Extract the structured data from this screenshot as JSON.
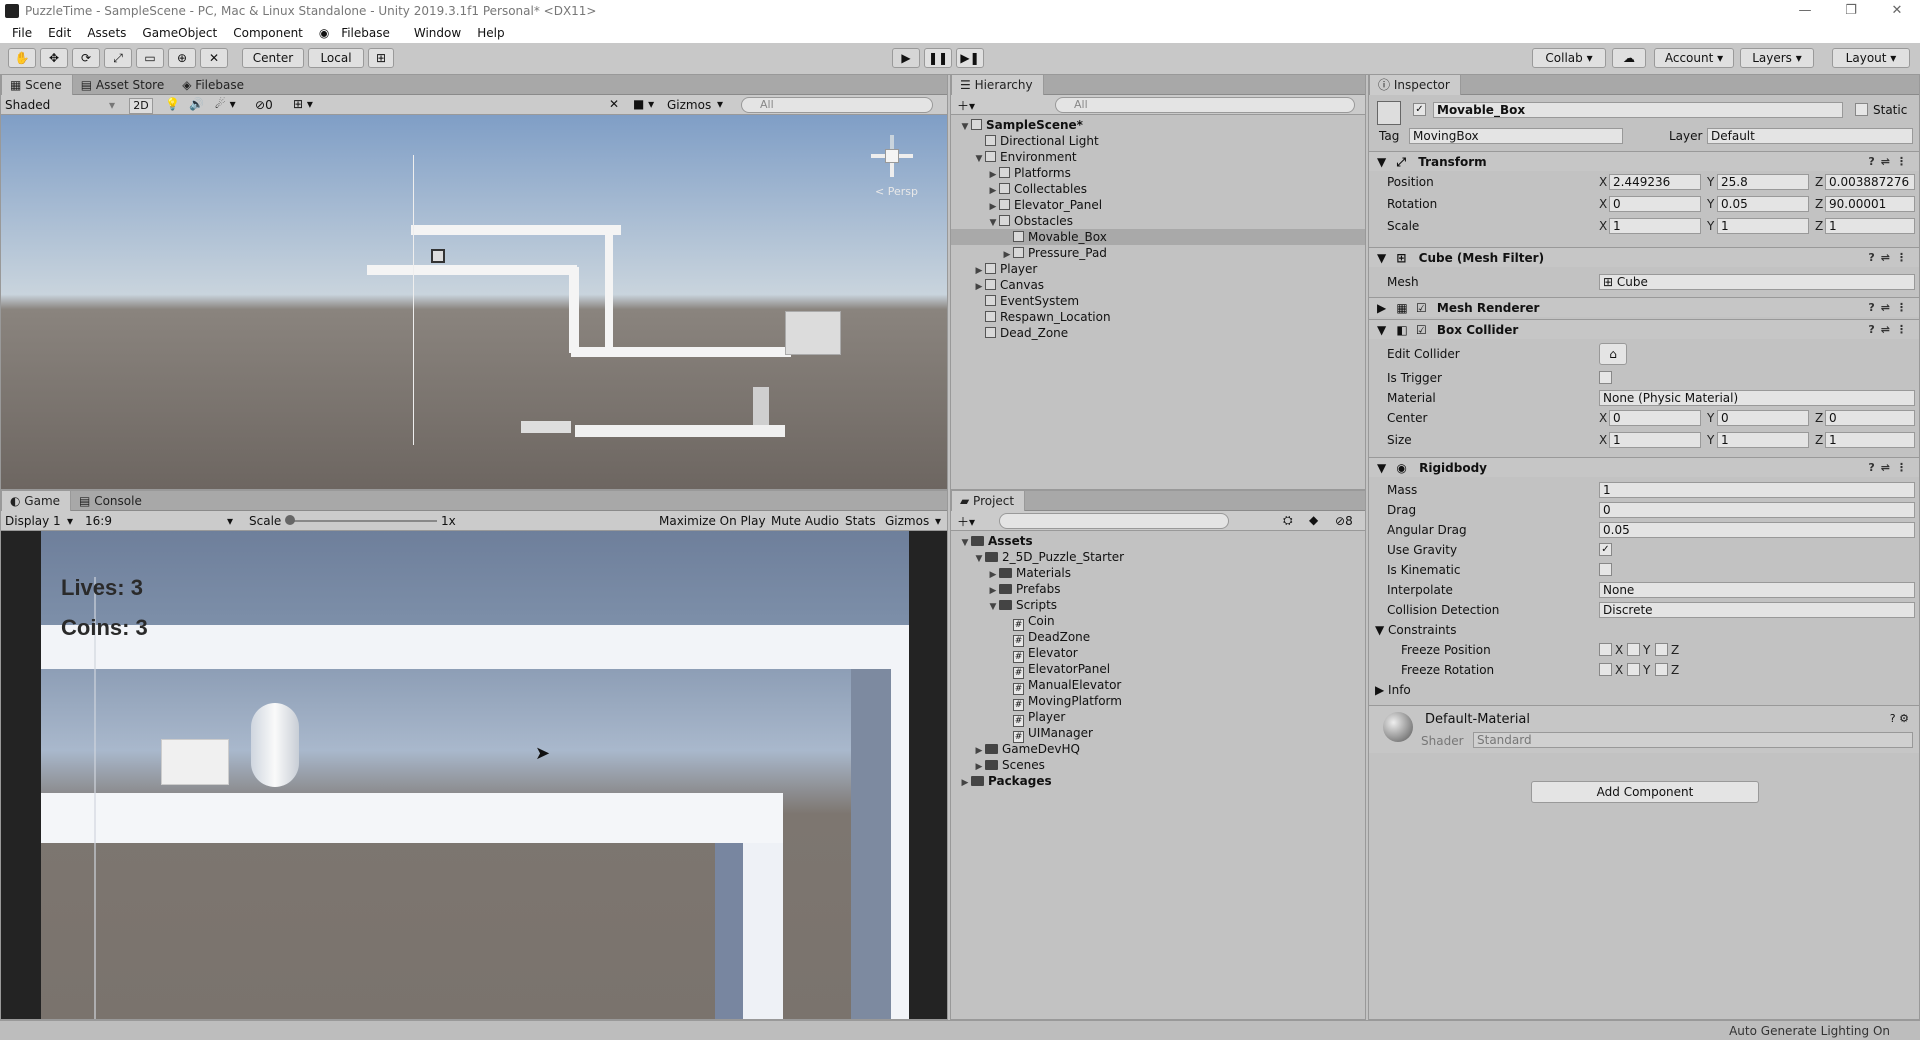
{
  "window": {
    "title": "PuzzleTime - SampleScene - PC, Mac & Linux Standalone - Unity 2019.3.1f1 Personal* <DX11>",
    "min": "—",
    "max": "❐",
    "close": "✕"
  },
  "menu": [
    "File",
    "Edit",
    "Assets",
    "GameObject",
    "Component",
    "Filebase",
    "Window",
    "Help"
  ],
  "toolbar": {
    "center": "Center",
    "local": "Local",
    "collab": "Collab",
    "account": "Account",
    "layers": "Layers",
    "layout": "Layout"
  },
  "scene": {
    "tabs": [
      "Scene",
      "Asset Store",
      "Filebase"
    ],
    "shading": "Shaded",
    "mode2d": "2D",
    "fx_count": "0",
    "gizmos": "Gizmos",
    "search": "All",
    "persp": "< Persp"
  },
  "game": {
    "tabs": [
      "Game",
      "Console"
    ],
    "display": "Display 1",
    "aspect": "16:9",
    "scale_label": "Scale",
    "scale_value": "1x",
    "maximize": "Maximize On Play",
    "mute": "Mute Audio",
    "stats": "Stats",
    "gizmos": "Gizmos",
    "lives": "Lives: 3",
    "coins": "Coins: 3"
  },
  "hierarchy": {
    "tab": "Hierarchy",
    "search": "All",
    "items": [
      {
        "label": "SampleScene*",
        "depth": 0,
        "arrow": "▼",
        "bold": true
      },
      {
        "label": "Directional Light",
        "depth": 1,
        "arrow": ""
      },
      {
        "label": "Environment",
        "depth": 1,
        "arrow": "▼"
      },
      {
        "label": "Platforms",
        "depth": 2,
        "arrow": "▶"
      },
      {
        "label": "Collectables",
        "depth": 2,
        "arrow": "▶"
      },
      {
        "label": "Elevator_Panel",
        "depth": 2,
        "arrow": "▶"
      },
      {
        "label": "Obstacles",
        "depth": 2,
        "arrow": "▼"
      },
      {
        "label": "Movable_Box",
        "depth": 3,
        "arrow": "",
        "selected": true
      },
      {
        "label": "Pressure_Pad",
        "depth": 3,
        "arrow": "▶"
      },
      {
        "label": "Player",
        "depth": 1,
        "arrow": "▶"
      },
      {
        "label": "Canvas",
        "depth": 1,
        "arrow": "▶"
      },
      {
        "label": "EventSystem",
        "depth": 1,
        "arrow": ""
      },
      {
        "label": "Respawn_Location",
        "depth": 1,
        "arrow": ""
      },
      {
        "label": "Dead_Zone",
        "depth": 1,
        "arrow": ""
      }
    ]
  },
  "project": {
    "tab": "Project",
    "hidden_count": "8",
    "items": [
      {
        "label": "Assets",
        "depth": 0,
        "arrow": "▼",
        "type": "folder",
        "bold": true
      },
      {
        "label": "2_5D_Puzzle_Starter",
        "depth": 1,
        "arrow": "▼",
        "type": "folder"
      },
      {
        "label": "Materials",
        "depth": 2,
        "arrow": "▶",
        "type": "folder"
      },
      {
        "label": "Prefabs",
        "depth": 2,
        "arrow": "▶",
        "type": "folder"
      },
      {
        "label": "Scripts",
        "depth": 2,
        "arrow": "▼",
        "type": "folder"
      },
      {
        "label": "Coin",
        "depth": 3,
        "arrow": "",
        "type": "script"
      },
      {
        "label": "DeadZone",
        "depth": 3,
        "arrow": "",
        "type": "script"
      },
      {
        "label": "Elevator",
        "depth": 3,
        "arrow": "",
        "type": "script"
      },
      {
        "label": "ElevatorPanel",
        "depth": 3,
        "arrow": "",
        "type": "script"
      },
      {
        "label": "ManualElevator",
        "depth": 3,
        "arrow": "",
        "type": "script"
      },
      {
        "label": "MovingPlatform",
        "depth": 3,
        "arrow": "",
        "type": "script"
      },
      {
        "label": "Player",
        "depth": 3,
        "arrow": "",
        "type": "script"
      },
      {
        "label": "UIManager",
        "depth": 3,
        "arrow": "",
        "type": "script"
      },
      {
        "label": "GameDevHQ",
        "depth": 1,
        "arrow": "▶",
        "type": "folder"
      },
      {
        "label": "Scenes",
        "depth": 1,
        "arrow": "▶",
        "type": "folder"
      },
      {
        "label": "Packages",
        "depth": 0,
        "arrow": "▶",
        "type": "folder",
        "bold": true
      }
    ]
  },
  "inspector": {
    "tab": "Inspector",
    "name": "Movable_Box",
    "static": "Static",
    "tag_label": "Tag",
    "tag": "MovingBox",
    "layer_label": "Layer",
    "layer": "Default",
    "transform": {
      "title": "Transform",
      "position_label": "Position",
      "rotation_label": "Rotation",
      "scale_label": "Scale",
      "pos": {
        "x": "2.449236",
        "y": "25.8",
        "z": "0.003887276"
      },
      "rot": {
        "x": "0",
        "y": "0.05",
        "z": "90.00001"
      },
      "scale": {
        "x": "1",
        "y": "1",
        "z": "1"
      }
    },
    "mesh_filter": {
      "title": "Cube (Mesh Filter)",
      "mesh_label": "Mesh",
      "mesh": "Cube"
    },
    "mesh_renderer": {
      "title": "Mesh Renderer"
    },
    "box_collider": {
      "title": "Box Collider",
      "edit_label": "Edit Collider",
      "trigger_label": "Is Trigger",
      "material_label": "Material",
      "material": "None (Physic Material)",
      "center_label": "Center",
      "center": {
        "x": "0",
        "y": "0",
        "z": "0"
      },
      "size_label": "Size",
      "size": {
        "x": "1",
        "y": "1",
        "z": "1"
      }
    },
    "rigidbody": {
      "title": "Rigidbody",
      "mass_label": "Mass",
      "mass": "1",
      "drag_label": "Drag",
      "drag": "0",
      "ang_label": "Angular Drag",
      "ang": "0.05",
      "gravity_label": "Use Gravity",
      "kinematic_label": "Is Kinematic",
      "interp_label": "Interpolate",
      "interp": "None",
      "coll_label": "Collision Detection",
      "coll": "Discrete",
      "constraints_label": "Constraints",
      "freeze_pos": "Freeze Position",
      "freeze_rot": "Freeze Rotation",
      "x": "X",
      "y": "Y",
      "z": "Z",
      "info": "Info"
    },
    "material": {
      "name": "Default-Material",
      "shader_label": "Shader",
      "shader": "Standard"
    },
    "add_component": "Add Component"
  },
  "status": {
    "text": "Auto Generate Lighting On"
  }
}
